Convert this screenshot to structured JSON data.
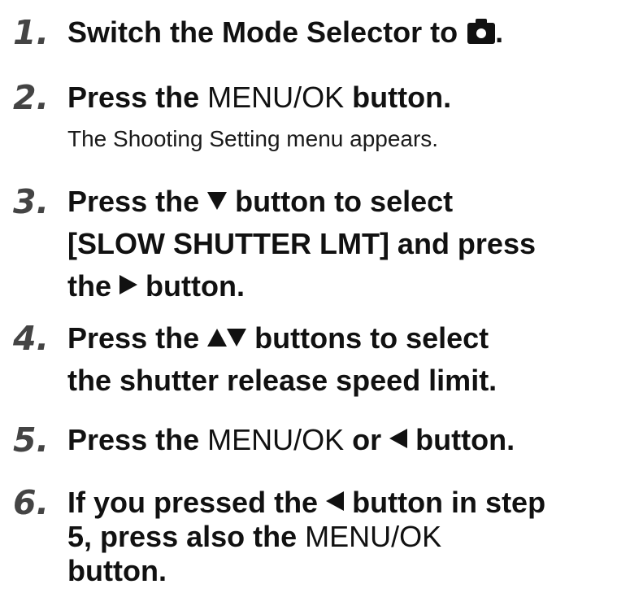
{
  "steps": [
    {
      "number": "1.",
      "parts": [
        "Switch the Mode Selector to",
        "."
      ]
    },
    {
      "number": "2.",
      "parts": [
        "Press the",
        "MENU/OK",
        "button."
      ],
      "note": "The Shooting Setting menu appears."
    },
    {
      "number": "3.",
      "line1": [
        "Press the",
        "button to select"
      ],
      "line2": "[SLOW SHUTTER LMT] and press",
      "line3": [
        "the",
        "button."
      ]
    },
    {
      "number": "4.",
      "line1": [
        "Press the",
        "buttons to select"
      ],
      "line2": "the shutter release speed limit."
    },
    {
      "number": "5.",
      "parts": [
        "Press the",
        "MENU/OK",
        "or",
        "button."
      ]
    },
    {
      "number": "6.",
      "line1": [
        "If you pressed the",
        "button in step"
      ],
      "line2": [
        "5, press also the",
        "MENU/OK"
      ],
      "line3": "button."
    }
  ],
  "icons": {
    "camera": "camera-icon",
    "down": "down-arrow-icon",
    "up": "up-arrow-icon",
    "right": "right-arrow-icon",
    "left": "left-arrow-icon"
  },
  "colors": {
    "text": "#111111",
    "step_number": "#444444"
  }
}
